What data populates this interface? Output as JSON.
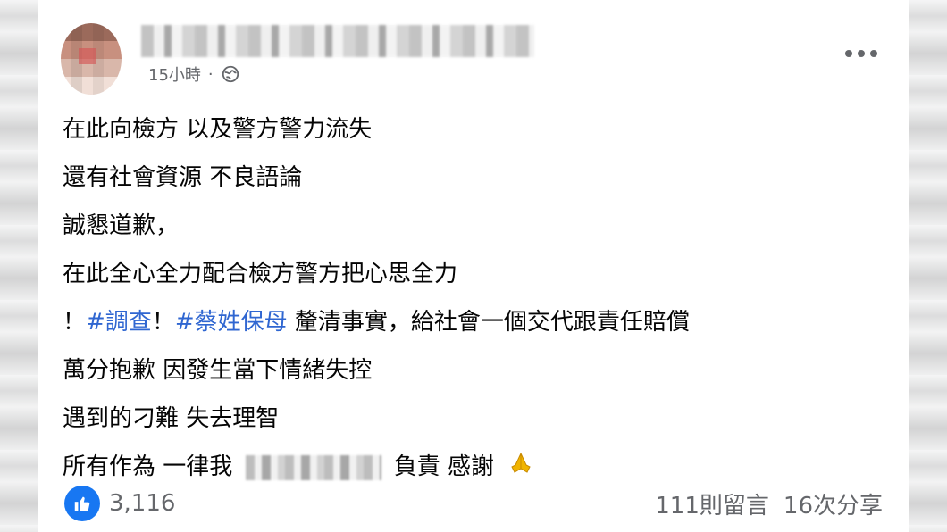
{
  "post": {
    "time": "15小時",
    "lines": [
      "在此向檢方 以及警方警力流失",
      "還有社會資源 不良語論",
      "誠懇道歉，",
      "在此全心全力配合檢方警方把心思全力",
      "",
      "萬分抱歉 因發生當下情緒失控",
      "遇到的刁難 失去理智",
      ""
    ],
    "line5": {
      "prefix": "！",
      "hashtag1": "#調查",
      "mid": "！",
      "hashtag2": "#蔡姓保母",
      "suffix": " 釐清事實，給社會一個交代跟責任賠償"
    },
    "line8": {
      "prefix": "所有作為 一律我",
      "suffix": "負責 感謝"
    }
  },
  "footer": {
    "likes": "3,116",
    "comments": "111則留言",
    "shares": "16次分享"
  },
  "icons": {
    "globe": "globe-icon",
    "more": "more-icon",
    "like": "like-icon",
    "pray": "pray-icon"
  },
  "colors": {
    "hashtag": "#2f66d1",
    "like_blue": "#1877f2",
    "meta_gray": "#65676b"
  }
}
